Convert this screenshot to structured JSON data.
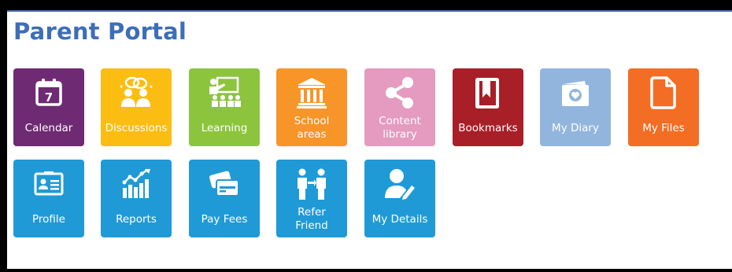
{
  "page": {
    "title": "Parent Portal"
  },
  "tiles": [
    {
      "label": "Calendar",
      "color": "#6e2a72",
      "icon": "calendar-icon"
    },
    {
      "label": "Discussions",
      "color": "#fbbd12",
      "icon": "discussions-icon"
    },
    {
      "label": "Learning",
      "color": "#8cc43d",
      "icon": "learning-icon"
    },
    {
      "label": "School\nareas",
      "color": "#f79528",
      "icon": "school-building-icon"
    },
    {
      "label": "Content\nlibrary",
      "color": "#e49bbf",
      "icon": "share-icon"
    },
    {
      "label": "Bookmarks",
      "color": "#a81f28",
      "icon": "bookmark-icon"
    },
    {
      "label": "My Diary",
      "color": "#92b5de",
      "icon": "diary-icon"
    },
    {
      "label": "My Files",
      "color": "#f36d24",
      "icon": "file-icon"
    },
    {
      "label": "Profile",
      "color": "#1f9ad6",
      "icon": "profile-card-icon"
    },
    {
      "label": "Reports",
      "color": "#1f9ad6",
      "icon": "reports-chart-icon"
    },
    {
      "label": "Pay Fees",
      "color": "#1f9ad6",
      "icon": "payment-card-icon"
    },
    {
      "label": "Refer\nFriend",
      "color": "#1f9ad6",
      "icon": "refer-friend-icon"
    },
    {
      "label": "My Details",
      "color": "#1f9ad6",
      "icon": "user-edit-icon"
    }
  ]
}
